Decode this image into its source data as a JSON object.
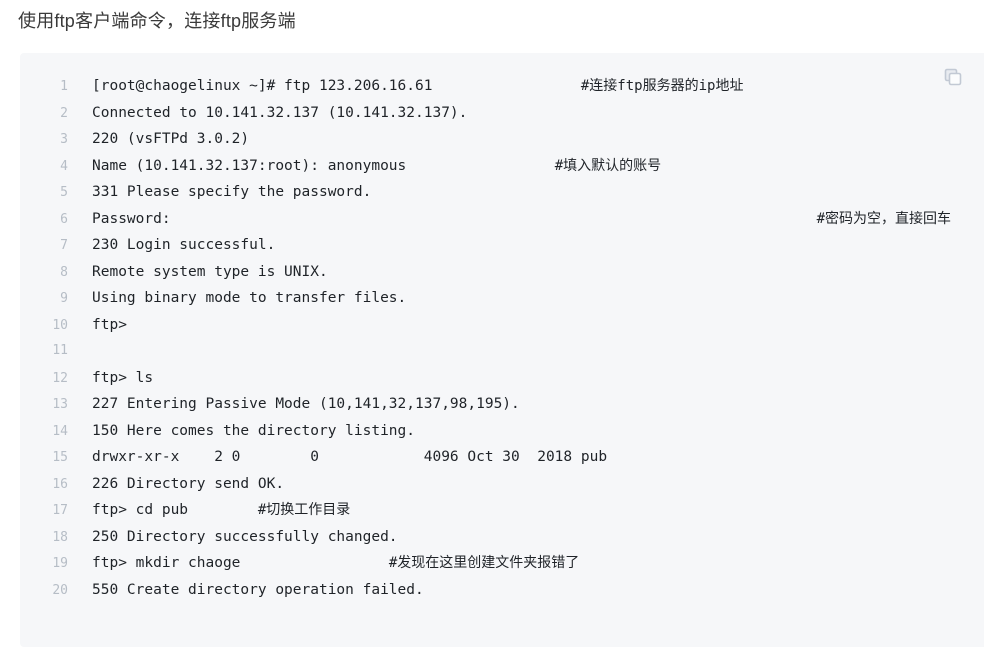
{
  "page": {
    "title": "使用ftp客户端命令，连接ftp服务端",
    "background_color": "#ffffff"
  },
  "code_block": {
    "background_color": "#f6f7f9",
    "line_number_color": "#b6bdc6",
    "text_color": "#1f2328",
    "copy_button": {
      "icon": "copy-icon",
      "color": "#c6ccd6",
      "label": ""
    },
    "lines": [
      {
        "n": "1",
        "code": "[root@chaogelinux ~]# ftp 123.206.16.61",
        "comment": "#连接ftp服务器的ip地址",
        "comment_col": 56
      },
      {
        "n": "2",
        "code": "Connected to 10.141.32.137 (10.141.32.137).",
        "comment": "",
        "comment_col": 0
      },
      {
        "n": "3",
        "code": "220 (vsFTPd 3.0.2)",
        "comment": "",
        "comment_col": 0
      },
      {
        "n": "4",
        "code": "Name (10.141.32.137:root): anonymous",
        "comment": "#填入默认的账号",
        "comment_col": 53
      },
      {
        "n": "5",
        "code": "331 Please specify the password.",
        "comment": "",
        "comment_col": 0
      },
      {
        "n": "6",
        "code": "Password:",
        "comment": "#密码为空，直接回车",
        "comment_col": 83
      },
      {
        "n": "7",
        "code": "230 Login successful.",
        "comment": "",
        "comment_col": 0
      },
      {
        "n": "8",
        "code": "Remote system type is UNIX.",
        "comment": "",
        "comment_col": 0
      },
      {
        "n": "9",
        "code": "Using binary mode to transfer files.",
        "comment": "",
        "comment_col": 0
      },
      {
        "n": "10",
        "code": "ftp>",
        "comment": "",
        "comment_col": 0
      },
      {
        "n": "11",
        "code": "",
        "comment": "",
        "comment_col": 0
      },
      {
        "n": "12",
        "code": "ftp> ls",
        "comment": "",
        "comment_col": 0
      },
      {
        "n": "13",
        "code": "227 Entering Passive Mode (10,141,32,137,98,195).",
        "comment": "",
        "comment_col": 0
      },
      {
        "n": "14",
        "code": "150 Here comes the directory listing.",
        "comment": "",
        "comment_col": 0
      },
      {
        "n": "15",
        "code": "drwxr-xr-x    2 0        0            4096 Oct 30  2018 pub",
        "comment": "",
        "comment_col": 0
      },
      {
        "n": "16",
        "code": "226 Directory send OK.",
        "comment": "",
        "comment_col": 0
      },
      {
        "n": "17",
        "code": "ftp> cd pub",
        "comment": "#切换工作目录",
        "comment_col": 19
      },
      {
        "n": "18",
        "code": "250 Directory successfully changed.",
        "comment": "",
        "comment_col": 0
      },
      {
        "n": "19",
        "code": "ftp> mkdir chaoge",
        "comment": "#发现在这里创建文件夹报错了",
        "comment_col": 34
      },
      {
        "n": "20",
        "code": "550 Create directory operation failed.",
        "comment": "",
        "comment_col": 0
      }
    ]
  }
}
